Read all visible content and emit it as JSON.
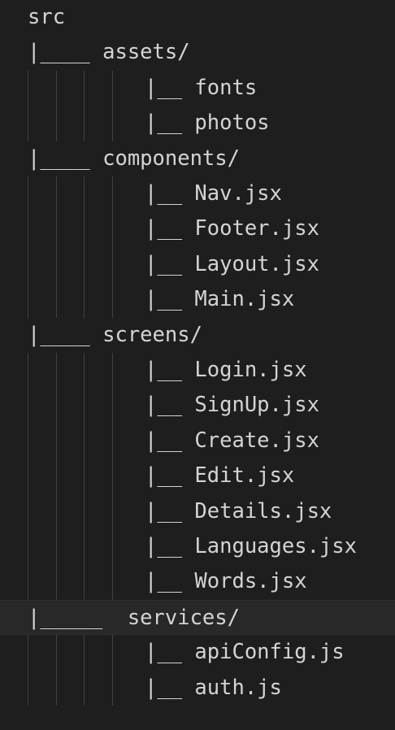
{
  "editor": {
    "lines": [
      {
        "text": "src",
        "indented": false,
        "current": false
      },
      {
        "text": "|____ assets/",
        "indented": false,
        "current": false
      },
      {
        "text": "|__ fonts",
        "indented": true,
        "current": false
      },
      {
        "text": "|__ photos",
        "indented": true,
        "current": false
      },
      {
        "text": "|____ components/",
        "indented": false,
        "current": false
      },
      {
        "text": "|__ Nav.jsx",
        "indented": true,
        "current": false
      },
      {
        "text": "|__ Footer.jsx",
        "indented": true,
        "current": false
      },
      {
        "text": "|__ Layout.jsx",
        "indented": true,
        "current": false
      },
      {
        "text": "|__ Main.jsx",
        "indented": true,
        "current": false
      },
      {
        "text": "|____ screens/",
        "indented": false,
        "current": false
      },
      {
        "text": "|__ Login.jsx",
        "indented": true,
        "current": false
      },
      {
        "text": "|__ SignUp.jsx",
        "indented": true,
        "current": false
      },
      {
        "text": "|__ Create.jsx",
        "indented": true,
        "current": false
      },
      {
        "text": "|__ Edit.jsx",
        "indented": true,
        "current": false
      },
      {
        "text": "|__ Details.jsx",
        "indented": true,
        "current": false
      },
      {
        "text": "|__ Languages.jsx",
        "indented": true,
        "current": false
      },
      {
        "text": "|__ Words.jsx",
        "indented": true,
        "current": false
      },
      {
        "text": "|_____  services/",
        "indented": false,
        "current": true
      },
      {
        "text": "|__ apiConfig.js",
        "indented": true,
        "current": false
      },
      {
        "text": "|__ auth.js",
        "indented": true,
        "current": false
      }
    ],
    "colors": {
      "background": "#1e1e1e",
      "text": "#d4d4d4",
      "indent_guide": "#404040",
      "current_line": "#282828"
    }
  }
}
